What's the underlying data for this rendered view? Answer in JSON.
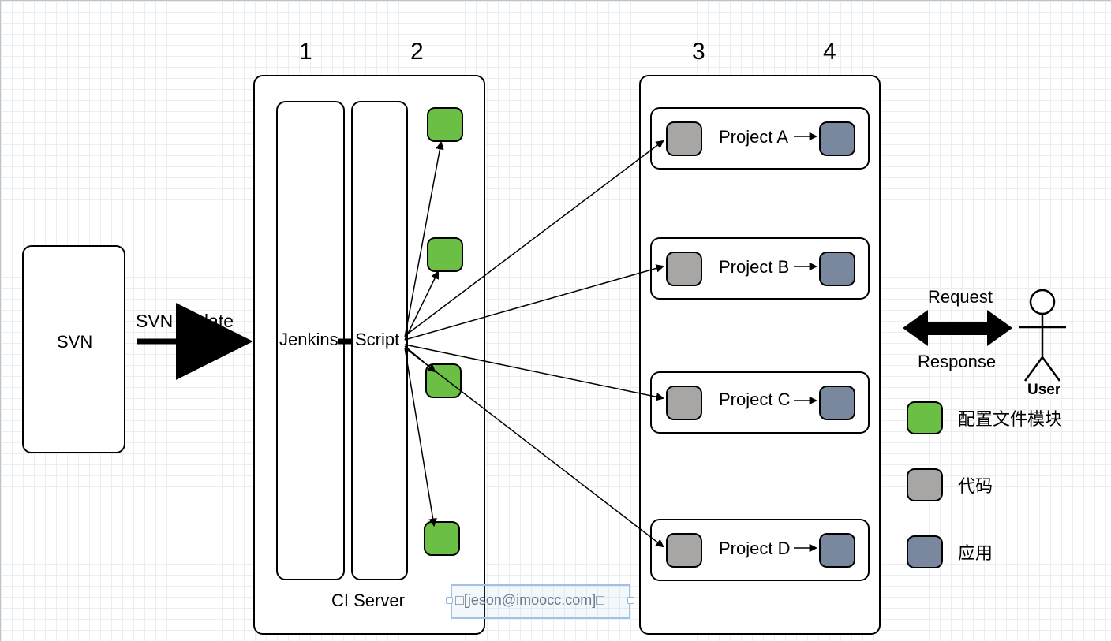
{
  "numbers": {
    "n1": "1",
    "n2": "2",
    "n3": "3",
    "n4": "4"
  },
  "svn": {
    "box": "SVN",
    "edge": "SVN update"
  },
  "ci": {
    "jenkins": "Jenkins",
    "script": "Script",
    "caption": "CI Server"
  },
  "projects": {
    "a": "Project A",
    "b": "Project B",
    "c": "Project C",
    "d": "Project D"
  },
  "rr": {
    "req": "Request",
    "res": "Response"
  },
  "user": "User",
  "legend": {
    "g": "配置文件模块",
    "gr": "代码",
    "bl": "应用"
  },
  "email": "□[jeson@imoocc.com]□"
}
